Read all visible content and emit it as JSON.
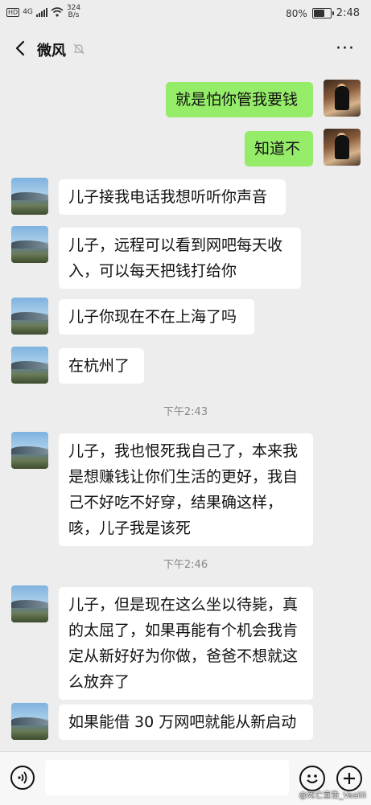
{
  "status": {
    "hd": "HD",
    "net": "4G",
    "speed_value": "324",
    "speed_unit": "B/s",
    "battery": "80%",
    "battery_level": 0.8,
    "time": "2:48"
  },
  "nav": {
    "title": "微风",
    "more": "···"
  },
  "messages": {
    "m1": "就是怕你管我要钱",
    "m2": "知道不",
    "m3": "儿子接我电话我想听听你声音",
    "m4": "儿子，远程可以看到网吧每天收入，可以每天把钱打给你",
    "m5": "儿子你现在不在上海了吗",
    "m6": "在杭州了",
    "t1": "下午2:43",
    "m7": "儿子，我也恨死我自己了，本来我是想赚钱让你们生活的更好，我自己不好吃不好穿，结果确这样，咳，儿子我是该死",
    "t2": "下午2:46",
    "m8": "儿子，但是现在这么坐以待毙，真的太屈了，如果再能有个机会我肯定从新好好为你做，爸爸不想就这么放弃了",
    "m9": "如果能借 30 万网吧就能从新启动"
  },
  "watermark": "@死亡宣告_Vasilii",
  "colors": {
    "self_bubble": "#95ec69",
    "other_bubble": "#ffffff",
    "background": "#ededed"
  }
}
